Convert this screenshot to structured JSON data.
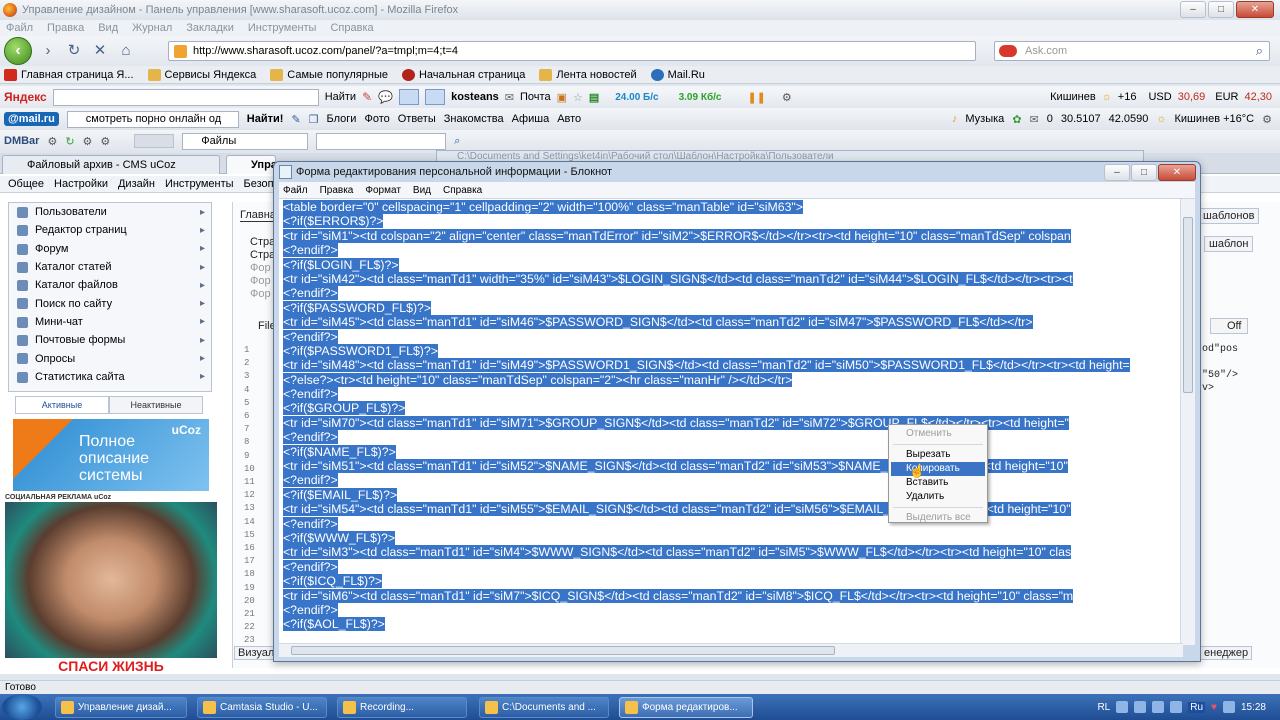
{
  "browser": {
    "title": "Управление дизайном - Панель управления [www.sharasoft.ucoz.com] - Mozilla Firefox",
    "menu": [
      "Файл",
      "Правка",
      "Вид",
      "Журнал",
      "Закладки",
      "Инструменты",
      "Справка"
    ],
    "url": "http://www.sharasoft.ucoz.com/panel/?a=tmpl;m=4;t=4",
    "search_placeholder": "Ask.com",
    "bookmarks": [
      "Главная страница Я...",
      "Сервисы Яндекса",
      "Самые популярные",
      "Начальная страница",
      "Лента новостей",
      "Mail.Ru"
    ]
  },
  "yandex_bar": {
    "logo": "Яндекс",
    "find": "Найти",
    "user": "kosteans",
    "mail": "Почта",
    "speed1": "24.00 Б/с",
    "speed2": "3.09 Кб/с",
    "city": "Кишинев",
    "temp": "+16",
    "usd_label": "USD",
    "usd": "30,69",
    "eur_label": "EUR",
    "eur": "42,30"
  },
  "mailru_bar": {
    "logo": "@mail.ru",
    "query": "смотреть порно онлайн од",
    "find": "Найти!",
    "links": [
      "Блоги",
      "Фото",
      "Ответы",
      "Знакомства",
      "Афиша",
      "Авто"
    ],
    "music": "Музыка",
    "count": "0",
    "coord1": "30.5107",
    "coord2": "42.0590",
    "weather": "Кишинев +16°C"
  },
  "dm_bar": {
    "logo": "DMBar",
    "select": "Файлы"
  },
  "tabs": [
    {
      "label": "Файловый архив - CMS uCoz"
    },
    {
      "label": "Упра"
    }
  ],
  "ucoz": {
    "menu": [
      "Общее",
      "Настройки",
      "Дизайн",
      "Инструменты",
      "Безопасность"
    ],
    "sidebar": [
      "Пользователи",
      "Редактор страниц",
      "Форум",
      "Каталог статей",
      "Каталог файлов",
      "Поиск по сайту",
      "Мини-чат",
      "Почтовые формы",
      "Опросы",
      "Статистика сайта"
    ],
    "side_tabs": [
      "Активные",
      "Неактивные"
    ],
    "ad_lines": [
      "Полное",
      "описание",
      "системы"
    ],
    "ad_brand": "uCoz",
    "social_label": "СОЦИАЛЬНАЯ РЕКЛАМА uCoz",
    "ad_bottom": "СПАСИ ЖИЗНЬ",
    "bg_fragments": {
      "glavna": "Главна",
      "stra1": "Стра",
      "stra2": "Стра",
      "for1": "Фор",
      "for2": "Фор",
      "for3": "Фор",
      "file": "File",
      "templates": "шаблонов",
      "template_btn": "шаблон",
      "off": "Off",
      "pos": "od\"pos",
      "fifty": "\"50\"/>",
      "v": "v>",
      "vizual": "Визуал",
      "manager": "енеджер"
    },
    "line_numbers": [
      "1",
      "2",
      "3",
      "4",
      "5",
      "6",
      "7",
      "8",
      "9",
      "10",
      "11",
      "12",
      "13",
      "14",
      "15",
      "16",
      "17",
      "18",
      "19",
      "20",
      "21",
      "22",
      "23"
    ]
  },
  "explorer_title": "C:\\Documents and Settings\\ket4in\\Рабочий стол\\Шаблон\\Настройка\\Пользователи",
  "notepad": {
    "title": "Форма редактирования персональной информации - Блокнот",
    "menu": [
      "Файл",
      "Правка",
      "Формат",
      "Вид",
      "Справка"
    ],
    "lines": [
      "<table border=\"0\" cellspacing=\"1\" cellpadding=\"2\" width=\"100%\" class=\"manTable\" id=\"siM63\">",
      "<?if($ERROR$)?>",
      "<tr id=\"siM1\"><td colspan=\"2\" align=\"center\" class=\"manTdError\" id=\"siM2\">$ERROR$</td></tr><tr><td height=\"10\" class=\"manTdSep\" colspan",
      "<?endif?>",
      "<?if($LOGIN_FL$)?>",
      "<tr id=\"siM42\"><td class=\"manTd1\" width=\"35%\" id=\"siM43\">$LOGIN_SIGN$</td><td class=\"manTd2\" id=\"siM44\">$LOGIN_FL$</td></tr><tr><t",
      "<?endif?>",
      "<?if($PASSWORD_FL$)?>",
      "<tr id=\"siM45\"><td class=\"manTd1\" id=\"siM46\">$PASSWORD_SIGN$</td><td class=\"manTd2\" id=\"siM47\">$PASSWORD_FL$</td></tr>",
      "<?endif?>",
      "<?if($PASSWORD1_FL$)?>",
      "<tr id=\"siM48\"><td class=\"manTd1\" id=\"siM49\">$PASSWORD1_SIGN$</td><td class=\"manTd2\" id=\"siM50\">$PASSWORD1_FL$</td></tr><tr><td height=",
      "<?else?><tr><td height=\"10\" class=\"manTdSep\" colspan=\"2\"><hr class=\"manHr\" /></td></tr>",
      "<?endif?>",
      "<?if($GROUP_FL$)?>",
      "<tr id=\"siM70\"><td class=\"manTd1\" id=\"siM71\">$GROUP_SIGN$</td><td class=\"manTd2\" id=\"siM72\">$GROUP_FL$</td></tr><tr><td height=\"",
      "<?endif?>",
      "<?if($NAME_FL$)?>",
      "<tr id=\"siM51\"><td class=\"manTd1\" id=\"siM52\">$NAME_SIGN$</td><td class=\"manTd2\" id=\"siM53\">$NAME_FL$</td></tr><tr><td height=\"10\"",
      "<?endif?>",
      "<?if($EMAIL_FL$)?>",
      "<tr id=\"siM54\"><td class=\"manTd1\" id=\"siM55\">$EMAIL_SIGN$</td><td class=\"manTd2\" id=\"siM56\">$EMAIL_FL$</td></tr><tr><td height=\"10\"",
      "<?endif?>",
      "<?if($WWW_FL$)?>",
      "<tr id=\"siM3\"><td class=\"manTd1\" id=\"siM4\">$WWW_SIGN$</td><td class=\"manTd2\" id=\"siM5\">$WWW_FL$</td></tr><tr><td height=\"10\" clas",
      "<?endif?>",
      "<?if($ICQ_FL$)?>",
      "<tr id=\"siM6\"><td class=\"manTd1\" id=\"siM7\">$ICQ_SIGN$</td><td class=\"manTd2\" id=\"siM8\">$ICQ_FL$</td></tr><tr><td height=\"10\" class=\"m",
      "<?endif?>",
      "<?if($AOL_FL$)?>"
    ]
  },
  "context_menu": {
    "undo": "Отменить",
    "cut": "Вырезать",
    "copy": "Копировать",
    "paste": "Вставить",
    "delete": "Удалить",
    "select_all": "Выделить все"
  },
  "status": "Готово",
  "taskbar": {
    "tasks": [
      "Управление дизай...",
      "Camtasia Studio - U...",
      "Recording...",
      "C:\\Documents and ...",
      "Форма редактиров..."
    ],
    "lang": "RL",
    "lang2": "Ru",
    "time": "15:28"
  }
}
